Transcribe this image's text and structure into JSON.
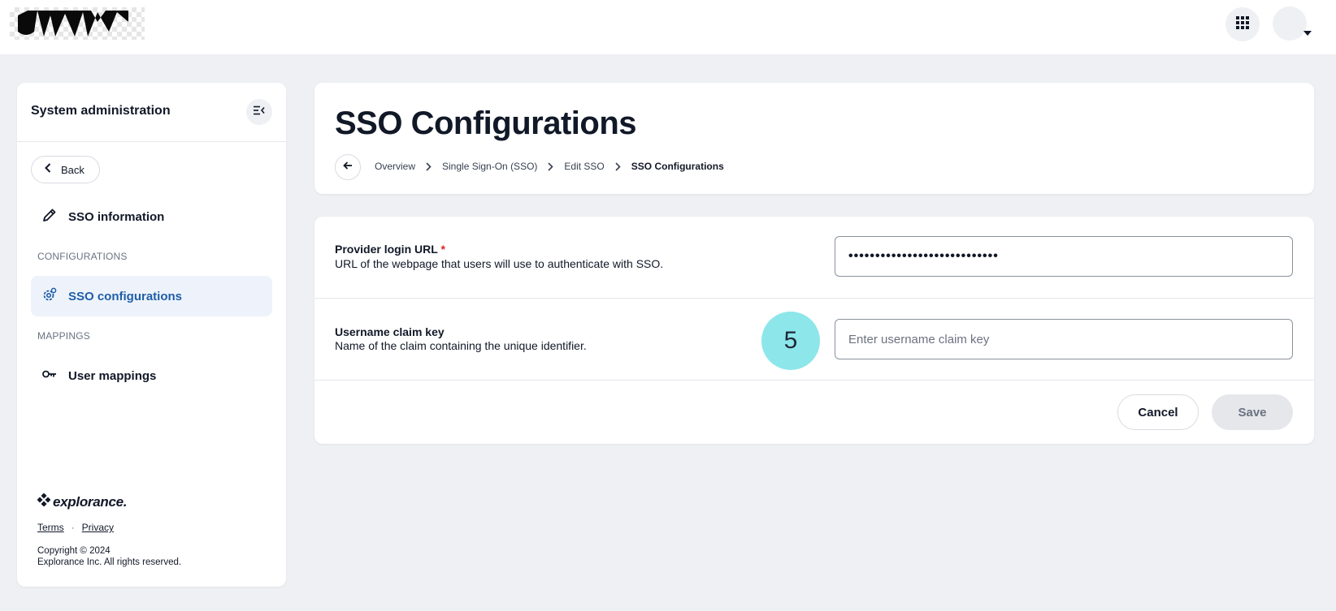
{
  "topbar": {
    "logo_icon": "brand-logo",
    "apps_icon": "grid-apps-icon",
    "avatar_icon": "user-avatar",
    "caret_icon": "caret-down-icon"
  },
  "sidebar": {
    "title": "System administration",
    "collapse_icon": "collapse-menu-icon",
    "back_label": "Back",
    "items": [
      {
        "label": "SSO information",
        "icon": "pencil-icon",
        "active": false
      },
      {
        "section": "CONFIGURATIONS"
      },
      {
        "label": "SSO configurations",
        "icon": "gear-icon",
        "active": true
      },
      {
        "section": "MAPPINGS"
      },
      {
        "label": "User mappings",
        "icon": "key-icon",
        "active": false
      }
    ],
    "footer": {
      "brand_name": "explorance.",
      "terms": "Terms",
      "separator": "·",
      "privacy": "Privacy",
      "copyright_line1": "Copyright © 2024",
      "copyright_line2": "Explorance Inc. All rights reserved."
    }
  },
  "header": {
    "title": "SSO Configurations",
    "breadcrumb": [
      "Overview",
      "Single Sign-On (SSO)",
      "Edit SSO",
      "SSO Configurations"
    ]
  },
  "form": {
    "provider_url": {
      "label": "Provider login URL",
      "required_mark": "*",
      "description": "URL of the webpage that users will use to authenticate with SSO.",
      "value": "••••••••••••••••••••••••••••"
    },
    "username_claim": {
      "label": "Username claim key",
      "description": "Name of the claim containing the unique identifier.",
      "placeholder": "Enter username claim key",
      "value": ""
    },
    "step_badge": "5",
    "cancel_label": "Cancel",
    "save_label": "Save"
  },
  "colors": {
    "accent": "#1f5ea8",
    "active_bg": "#eef3fb",
    "badge": "#8de6ea",
    "page_bg": "#eff0f4",
    "required": "#dc2626"
  }
}
